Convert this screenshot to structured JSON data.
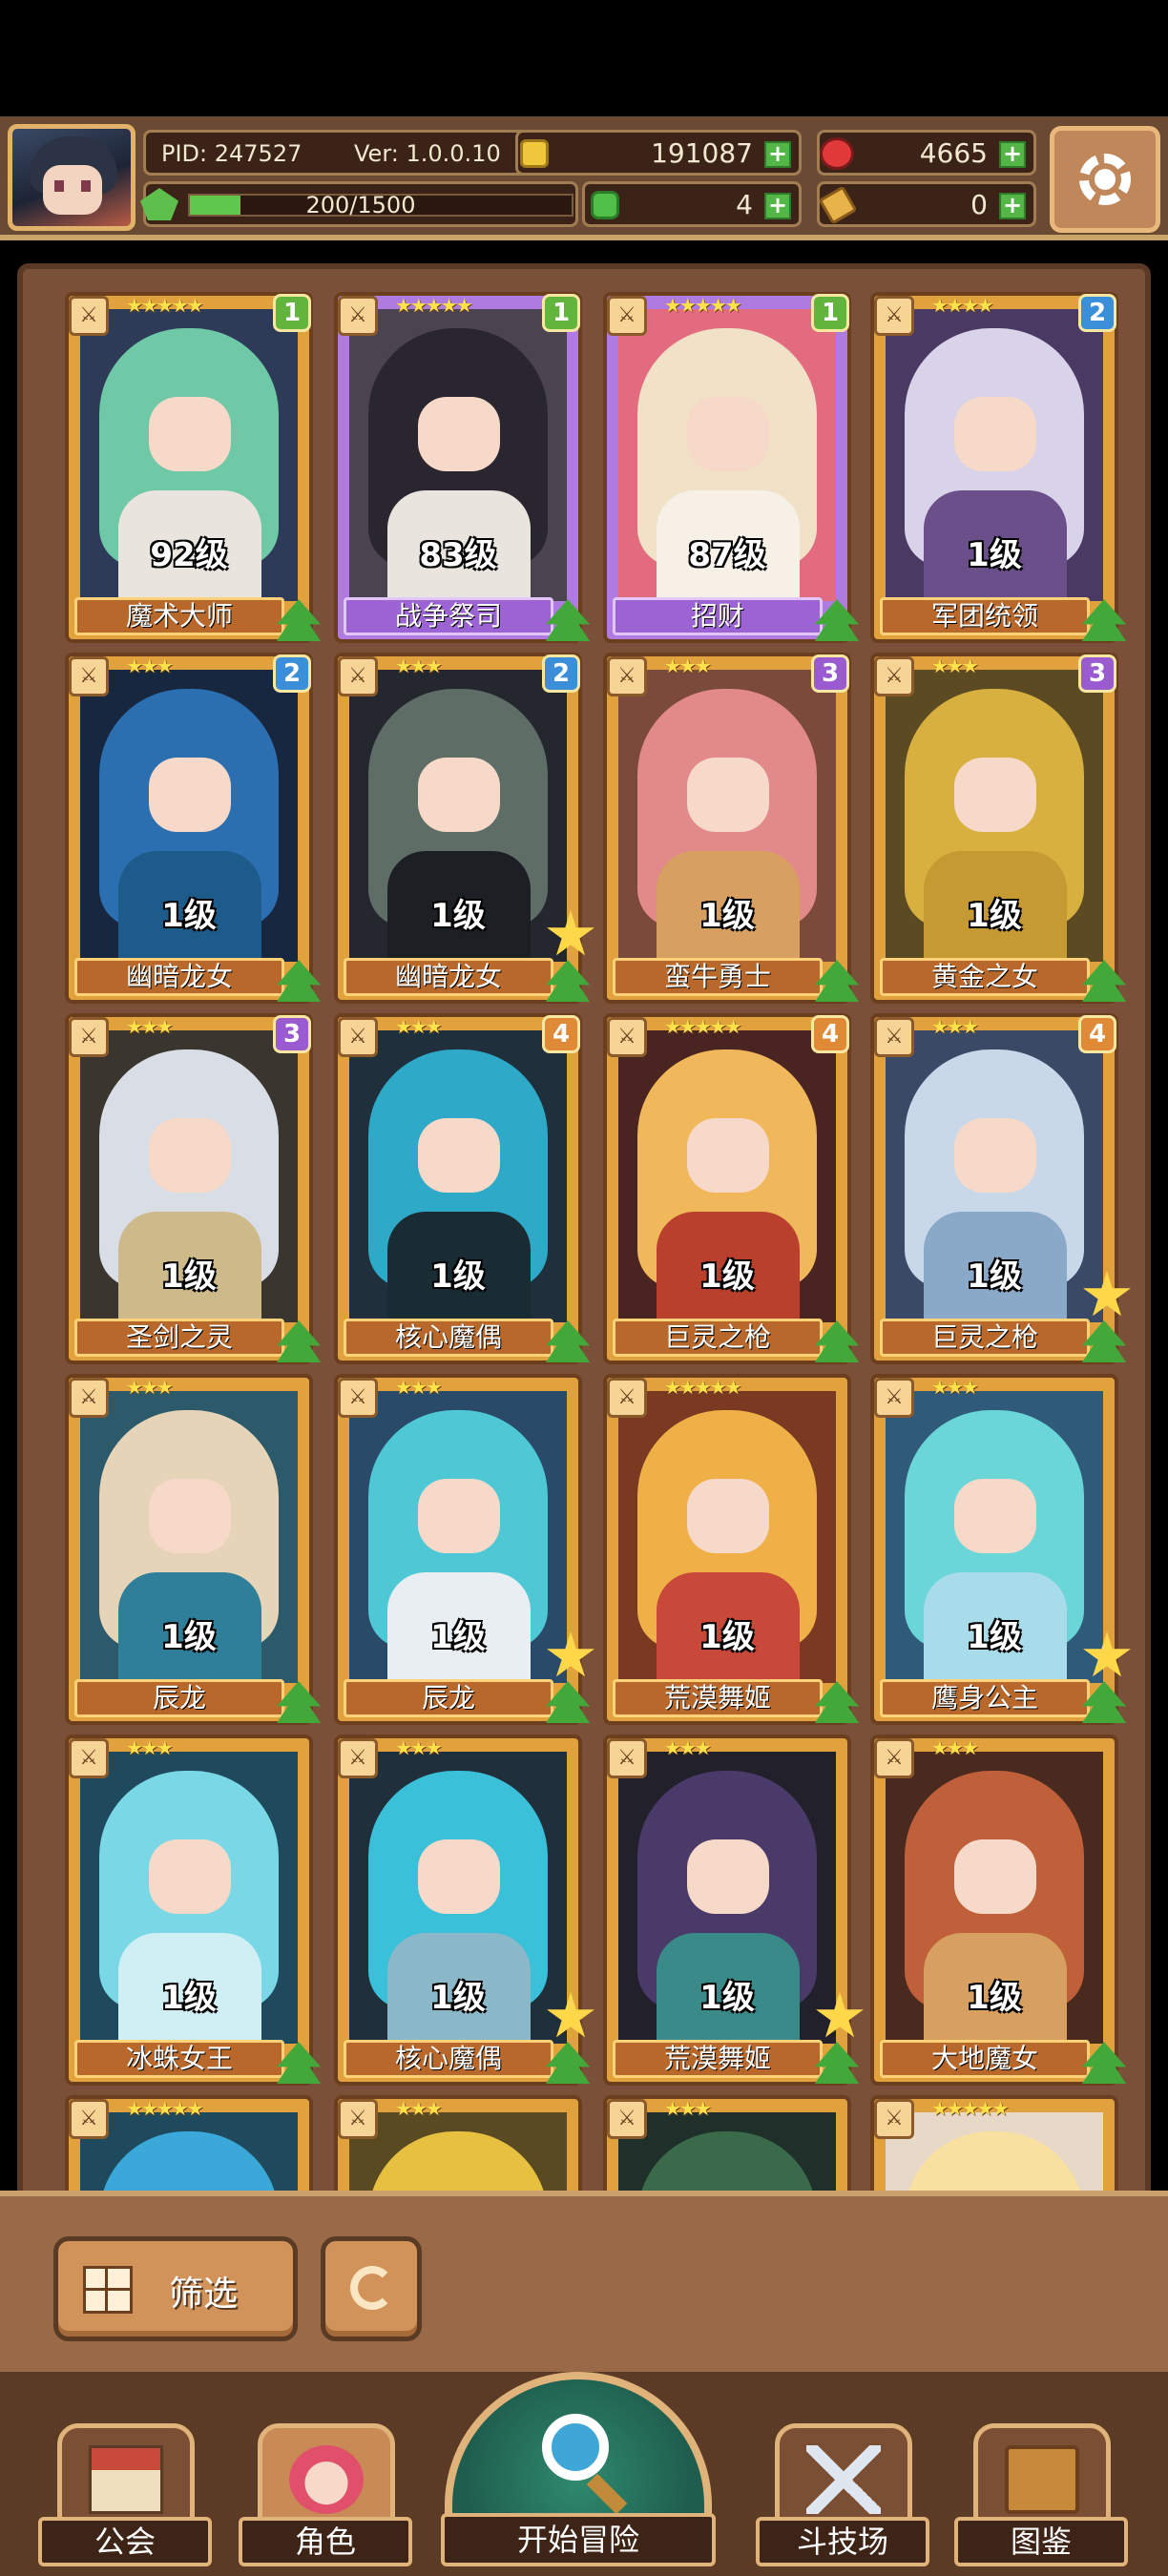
{
  "player": {
    "pid_label": "PID: 247527",
    "version_label": "Ver: 1.0.0.10",
    "exp_text": "200/1500",
    "exp_fraction": 0.133
  },
  "resources": {
    "gold": "191087",
    "ruby": "4665",
    "clover": "4",
    "ticket": "0"
  },
  "cards": [
    {
      "level": "92级",
      "name": "魔术大师",
      "stars": "★★★★★",
      "badge": "1",
      "badge_class": "",
      "frame": "gold",
      "colors": [
        "#6fc9a6",
        "#2d3b59",
        "#e9e5de"
      ],
      "star_mark": false
    },
    {
      "level": "83级",
      "name": "战争祭司",
      "stars": "★★★★★",
      "badge": "1",
      "badge_class": "",
      "frame": "purple",
      "colors": [
        "#2a2630",
        "#4b4350",
        "#e9e5de"
      ],
      "star_mark": false
    },
    {
      "level": "87级",
      "name": "招财",
      "stars": "★★★★★",
      "badge": "1",
      "badge_class": "",
      "frame": "purple",
      "colors": [
        "#f0e1c7",
        "#e36b7f",
        "#f6f0e6"
      ],
      "star_mark": false
    },
    {
      "level": "1级",
      "name": "军团统领",
      "stars": "★★★★",
      "badge": "2",
      "badge_class": "b2",
      "frame": "gold",
      "colors": [
        "#d9d3ea",
        "#4a3a63",
        "#6b4f8a"
      ],
      "star_mark": false
    },
    {
      "level": "1级",
      "name": "幽暗龙女",
      "stars": "★★★",
      "badge": "2",
      "badge_class": "b2",
      "frame": "gold",
      "colors": [
        "#2c6fb0",
        "#17273f",
        "#1d5c8a"
      ],
      "star_mark": false
    },
    {
      "level": "1级",
      "name": "幽暗龙女",
      "stars": "★★★",
      "badge": "2",
      "badge_class": "b2",
      "frame": "gold",
      "colors": [
        "#5e6e66",
        "#24282e",
        "#1c1f24"
      ],
      "star_mark": true
    },
    {
      "level": "1级",
      "name": "蛮牛勇士",
      "stars": "★★★",
      "badge": "3",
      "badge_class": "b3",
      "frame": "gold",
      "colors": [
        "#e28a8a",
        "#7b4a3a",
        "#d7a060"
      ],
      "star_mark": false
    },
    {
      "level": "1级",
      "name": "黄金之女",
      "stars": "★★★",
      "badge": "3",
      "badge_class": "b3",
      "frame": "gold",
      "colors": [
        "#d8b040",
        "#5b4a22",
        "#c59a32"
      ],
      "star_mark": false
    },
    {
      "level": "1级",
      "name": "圣剑之灵",
      "stars": "★★★",
      "badge": "3",
      "badge_class": "b3",
      "frame": "gold",
      "colors": [
        "#d9dde6",
        "#3b3530",
        "#cdb98a"
      ],
      "star_mark": false
    },
    {
      "level": "1级",
      "name": "核心魔偶",
      "stars": "★★★",
      "badge": "4",
      "badge_class": "b4",
      "frame": "gold",
      "colors": [
        "#2ea9c8",
        "#1f2f3b",
        "#1a2c33"
      ],
      "star_mark": false
    },
    {
      "level": "1级",
      "name": "巨灵之枪",
      "stars": "★★★★★",
      "badge": "4",
      "badge_class": "b4",
      "frame": "gold",
      "colors": [
        "#f0b85a",
        "#4a2420",
        "#b8402c"
      ],
      "star_mark": false
    },
    {
      "level": "1级",
      "name": "巨灵之枪",
      "stars": "★★★",
      "badge": "4",
      "badge_class": "b4",
      "frame": "gold",
      "colors": [
        "#c8d8e8",
        "#3a4a66",
        "#8aa8c8"
      ],
      "star_mark": true
    },
    {
      "level": "1级",
      "name": "辰龙",
      "stars": "★★★",
      "badge": "",
      "badge_class": "",
      "frame": "gold",
      "colors": [
        "#e6d4b8",
        "#2c5a6a",
        "#2f7f9a"
      ],
      "star_mark": false
    },
    {
      "level": "1级",
      "name": "辰龙",
      "stars": "★★★",
      "badge": "",
      "badge_class": "",
      "frame": "gold",
      "colors": [
        "#4fc8d6",
        "#2a4a6a",
        "#e8eef2"
      ],
      "star_mark": true
    },
    {
      "level": "1级",
      "name": "荒漠舞姬",
      "stars": "★★★★★",
      "badge": "",
      "badge_class": "",
      "frame": "gold",
      "colors": [
        "#f0b048",
        "#7a3a22",
        "#c8483a"
      ],
      "star_mark": false
    },
    {
      "level": "1级",
      "name": "鹰身公主",
      "stars": "★★★",
      "badge": "",
      "badge_class": "",
      "frame": "gold",
      "colors": [
        "#6ad6d8",
        "#2f5a7a",
        "#a8dcea"
      ],
      "star_mark": true
    },
    {
      "level": "1级",
      "name": "冰蛛女王",
      "stars": "★★★",
      "badge": "",
      "badge_class": "",
      "frame": "gold",
      "colors": [
        "#7ad8e6",
        "#1f4a5e",
        "#cfeff5"
      ],
      "star_mark": false
    },
    {
      "level": "1级",
      "name": "核心魔偶",
      "stars": "★★★",
      "badge": "",
      "badge_class": "",
      "frame": "gold",
      "colors": [
        "#3ac0d8",
        "#1f2f3b",
        "#8ab8c8"
      ],
      "star_mark": true
    },
    {
      "level": "1级",
      "name": "荒漠舞姬",
      "stars": "★★★",
      "badge": "",
      "badge_class": "",
      "frame": "gold",
      "colors": [
        "#4a3a6a",
        "#22202a",
        "#3a8a8a"
      ],
      "star_mark": true
    },
    {
      "level": "1级",
      "name": "大地魔女",
      "stars": "★★★",
      "badge": "",
      "badge_class": "",
      "frame": "gold",
      "colors": [
        "#c0603a",
        "#4a2a1e",
        "#d8a060"
      ],
      "star_mark": false
    },
    {
      "level": "",
      "name": "",
      "stars": "★★★★★",
      "badge": "",
      "badge_class": "",
      "frame": "gold",
      "colors": [
        "#3aa8d8",
        "#1f4a5e",
        "#3aa8d8"
      ],
      "star_mark": false
    },
    {
      "level": "",
      "name": "",
      "stars": "★★★",
      "badge": "",
      "badge_class": "",
      "frame": "gold",
      "colors": [
        "#e8c040",
        "#5a4a22",
        "#e8c040"
      ],
      "star_mark": false
    },
    {
      "level": "",
      "name": "",
      "stars": "★★★",
      "badge": "",
      "badge_class": "",
      "frame": "gold",
      "colors": [
        "#3a6a4a",
        "#1f2f2a",
        "#3a6a4a"
      ],
      "star_mark": false
    },
    {
      "level": "",
      "name": "",
      "stars": "★★★★★",
      "badge": "",
      "badge_class": "",
      "frame": "gold",
      "colors": [
        "#f8e0a0",
        "#e8d8c8",
        "#f8e0a0"
      ],
      "star_mark": false
    }
  ],
  "toolbar": {
    "filter_label": "筛选"
  },
  "nav": {
    "guild": "公会",
    "character": "角色",
    "adventure": "开始冒险",
    "arena": "斗技场",
    "codex": "图鉴"
  }
}
